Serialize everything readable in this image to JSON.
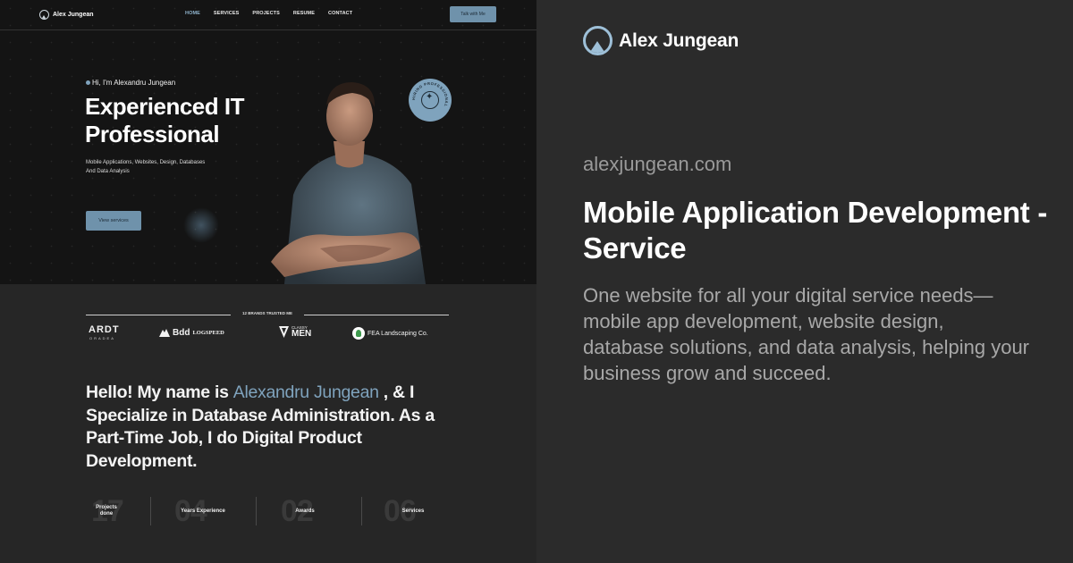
{
  "site": {
    "brand_name": "Alex Jungean",
    "nav": {
      "links": [
        "HOME",
        "SERVICES",
        "PROJECTS",
        "RESUME",
        "CONTACT"
      ],
      "active_index": 0,
      "cta_label": "Talk with Me"
    },
    "hero": {
      "greeting": "Hi, I'm Alexandru Jungean",
      "title": "Experienced IT Professional",
      "subtitle": "Mobile Applications, Websites, Design, Databases And Data Analysis",
      "button_label": "View services",
      "badge_text": "HIRING PROFESSIONAL"
    },
    "brands": {
      "label": "12 BRANDS TRUSTED ME",
      "logos": {
        "ardt": "ARDT",
        "ardt_sub": "ORADEA",
        "bdd": "Bdd",
        "bdd_sub": "LOGSPEED",
        "men_top": "CLASSY",
        "men_main": "MEN",
        "fea": "FEA Landscaping Co."
      }
    },
    "about": {
      "prefix": "Hello! My name is ",
      "name": "Alexandru Jungean",
      "suffix": " , & I Specialize in Database Administration. As a Part-Time Job, I do Digital Product Development."
    },
    "stats": [
      {
        "number": "17",
        "label": "Projects done"
      },
      {
        "number": "04",
        "label": "Years Experience"
      },
      {
        "number": "02",
        "label": "Awards"
      },
      {
        "number": "06",
        "label": "Services"
      }
    ]
  },
  "card": {
    "brand_name": "Alex Jungean",
    "url": "alexjungean.com",
    "title": "Mobile Application Development - Service",
    "description": "One website for all your digital service needs—mobile app development, website design, database solutions, and data analysis, helping your business grow and succeed."
  },
  "colors": {
    "accent": "#7fa3bd",
    "background": "#2b2b2b",
    "hero_background": "#141414"
  }
}
